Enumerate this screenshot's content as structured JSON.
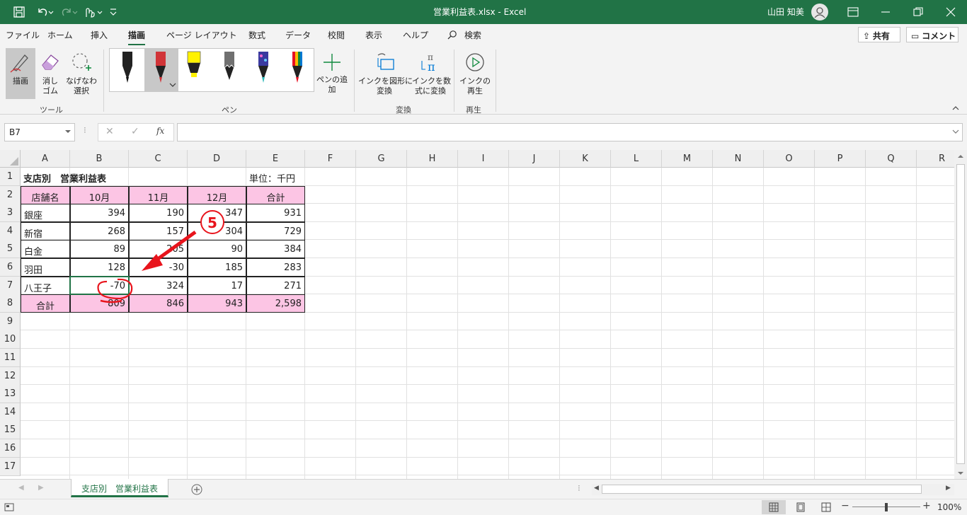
{
  "app": {
    "title": "営業利益表.xlsx - Excel",
    "user": "山田 知美"
  },
  "menu": {
    "tabs": [
      "ファイル",
      "ホーム",
      "挿入",
      "描画",
      "ページ レイアウト",
      "数式",
      "データ",
      "校閲",
      "表示",
      "ヘルプ"
    ],
    "search": "検索",
    "share": "共有",
    "comment": "コメント"
  },
  "ribbon": {
    "draw": "描画",
    "eraser": "消し\nゴム",
    "lasso": "なげなわ\n選択",
    "tools_group": "ツール",
    "pens_group": "ペン",
    "add_pen": "ペンの追\n加",
    "ink_to_shape": "インクを図形に\n変換",
    "ink_to_math": "インクを数\n式に変換",
    "convert_group": "変換",
    "replay": "インクの\n再生",
    "replay_group": "再生"
  },
  "formula": {
    "name_box": "B7",
    "fx": "fx",
    "value": ""
  },
  "columns": [
    "A",
    "B",
    "C",
    "D",
    "E",
    "F",
    "G",
    "H",
    "I",
    "J",
    "K",
    "L",
    "M",
    "N",
    "O",
    "P",
    "Q",
    "R"
  ],
  "rows": [
    "1",
    "2",
    "3",
    "4",
    "5",
    "6",
    "7",
    "8",
    "9",
    "10",
    "11",
    "12",
    "13",
    "14",
    "15",
    "16",
    "17"
  ],
  "table": {
    "title": "支店別　営業利益表",
    "unit": "単位：千円",
    "headers": [
      "店舗名",
      "10月",
      "11月",
      "12月",
      "合計"
    ],
    "data": [
      [
        "銀座",
        "394",
        "190",
        "347",
        "931"
      ],
      [
        "新宿",
        "268",
        "157",
        "304",
        "729"
      ],
      [
        "白金",
        "89",
        "205",
        "90",
        "384"
      ],
      [
        "羽田",
        "128",
        "-30",
        "185",
        "283"
      ],
      [
        "八王子",
        "-70",
        "324",
        "17",
        "271"
      ]
    ],
    "total": [
      "合計",
      "809",
      "846",
      "943",
      "2,598"
    ]
  },
  "annotation": {
    "number": "5",
    "color": "#e8141c"
  },
  "sheet": {
    "tab": "支店別　営業利益表"
  },
  "status": {
    "zoom": "100%"
  },
  "colors": {
    "excel_green": "#217346",
    "header_pink": "#fcc5e4",
    "ink_red": "#e8141c"
  }
}
